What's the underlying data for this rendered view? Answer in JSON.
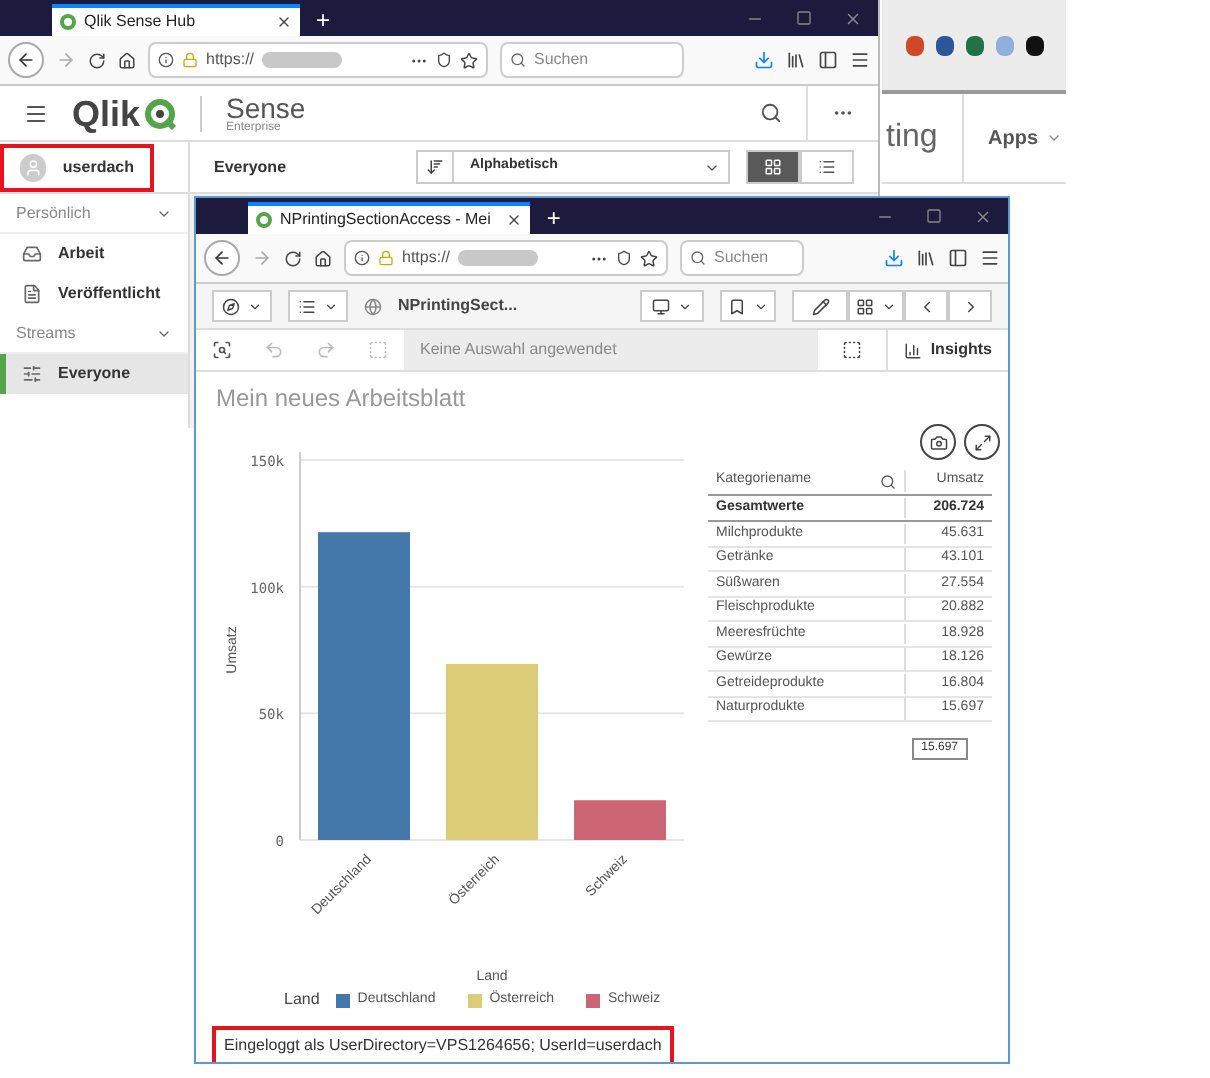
{
  "other_window": {
    "partial_text": "ting",
    "menu": "Apps"
  },
  "hub_window": {
    "tab_title": "Qlik Sense Hub",
    "new_tab": "+",
    "url": "https://",
    "search_placeholder": "Suchen",
    "logo_text": "Qlik",
    "product": "Sense",
    "edition": "Enterprise",
    "user": {
      "name": "userdach",
      "highlighted": true
    },
    "stream_title": "Everyone",
    "sort_value": "Alphabetisch",
    "views": [
      {
        "kind": "grid",
        "selected": true
      },
      {
        "kind": "list",
        "selected": false
      }
    ],
    "sidebar": [
      {
        "kind": "header",
        "label": "Persönlich",
        "expanded": true
      },
      {
        "kind": "work",
        "label": "Arbeit",
        "selected": false
      },
      {
        "kind": "published",
        "label": "Veröffentlicht",
        "selected": false
      },
      {
        "kind": "header",
        "label": "Streams",
        "expanded": true
      },
      {
        "kind": "stream",
        "label": "Everyone",
        "selected": true
      }
    ]
  },
  "app_window": {
    "tab_title": "NPrintingSectionAccess - Mei",
    "new_tab": "+",
    "url": "https://",
    "search_placeholder": "Suchen",
    "app_name": "NPrintingSect...",
    "selection_status": "Keine Auswahl angewendet",
    "insights": "Insights",
    "sheet_title": "Mein neues Arbeitsblatt",
    "chart_data": {
      "type": "bar",
      "xlabel": "Land",
      "ylabel": "Umsatz",
      "categories": [
        "Deutschland",
        "Österreich",
        "Schweiz"
      ],
      "series": [
        {
          "values": [
            121500,
            69500,
            15700
          ]
        }
      ],
      "ylim": [
        0,
        150000
      ],
      "yticks": [
        0,
        {
          "value": 50000,
          "label": "50k"
        },
        {
          "value": 100000,
          "label": "100k"
        },
        {
          "value": 150000,
          "label": "150k"
        }
      ]
    },
    "legend": {
      "title": "Land",
      "items": [
        {
          "label": "Deutschland",
          "color": "#4477aa"
        },
        {
          "label": "Österreich",
          "color": "#ddcc77"
        },
        {
          "label": "Schweiz",
          "color": "#cc6677"
        }
      ]
    },
    "table": {
      "columns": [
        "Kategoriename",
        "Umsatz"
      ],
      "totals": {
        "label": "Gesamtwerte",
        "value": "206.724"
      },
      "rows": [
        {
          "name": "Milchprodukte",
          "value": "45.631"
        },
        {
          "name": "Getränke",
          "value": "43.101"
        },
        {
          "name": "Süßwaren",
          "value": "27.554"
        },
        {
          "name": "Fleischprodukte",
          "value": "20.882"
        },
        {
          "name": "Meeresfrüchte",
          "value": "18.928"
        },
        {
          "name": "Gewürze",
          "value": "18.126"
        },
        {
          "name": "Getreideprodukte",
          "value": "16.804"
        },
        {
          "name": "Naturprodukte",
          "value": "15.697"
        }
      ]
    },
    "tooltip": "15.697",
    "footer": {
      "text": "Eingeloggt als UserDirectory=VPS1264656; UserId=userdach",
      "highlighted": true
    }
  }
}
